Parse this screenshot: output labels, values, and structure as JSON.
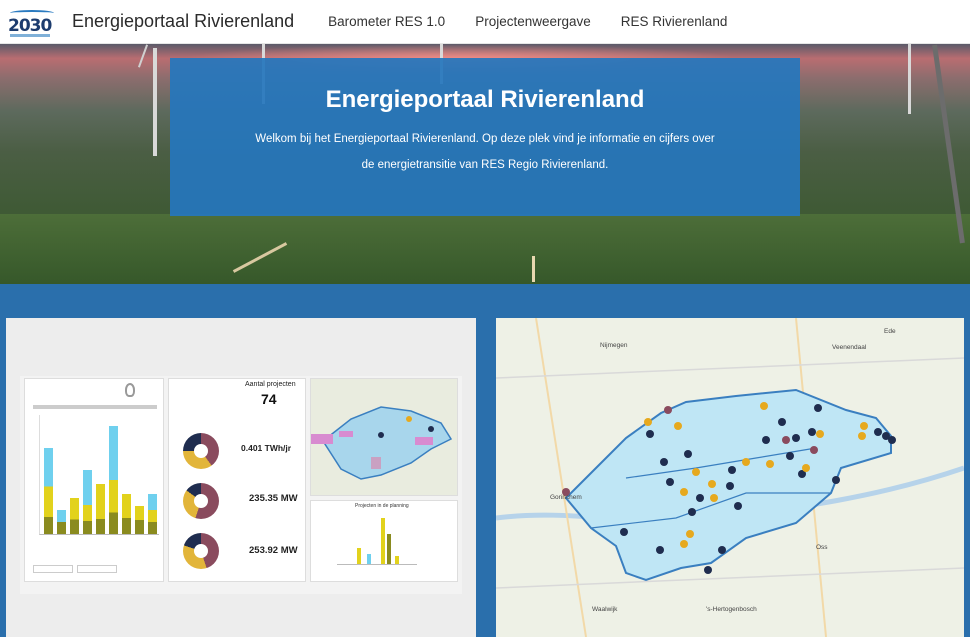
{
  "nav": {
    "logo_year": "2030",
    "site_title": "Energieportaal Rivierenland",
    "links": [
      "Barometer RES 1.0",
      "Projectenweergave",
      "RES Rivierenland"
    ]
  },
  "hero": {
    "title": "Energieportaal Rivierenland",
    "line1": "Welkom bij het Energieportaal Rivierenland. Op deze plek vind je informatie en cijfers over",
    "line2": "de energietransitie van RES Regio Rivierenland."
  },
  "dashboard": {
    "projects_label": "Aantal projecten",
    "projects_count": "74",
    "values": [
      "0.401 TWh/jr",
      "235.35 MW",
      "253.92 MW"
    ],
    "planning_title": "Projecten in de planning",
    "bar_colors": {
      "olive": "#8a8b1f",
      "yellow": "#e2d21c",
      "cyan": "#6fd0ee"
    }
  },
  "map": {
    "labels": [
      "Nijmegen",
      "Veenendaal",
      "Ede",
      "Gorinchem",
      "Oss",
      "'s-Hertogenbosch",
      "Waalwijk"
    ],
    "dot_colors": {
      "navy": "#1f2d4f",
      "gold": "#e6a91e",
      "rose": "#8a4b5e"
    }
  },
  "colors": {
    "accent": "#2a6fac",
    "hero_box": "#2676bc"
  }
}
